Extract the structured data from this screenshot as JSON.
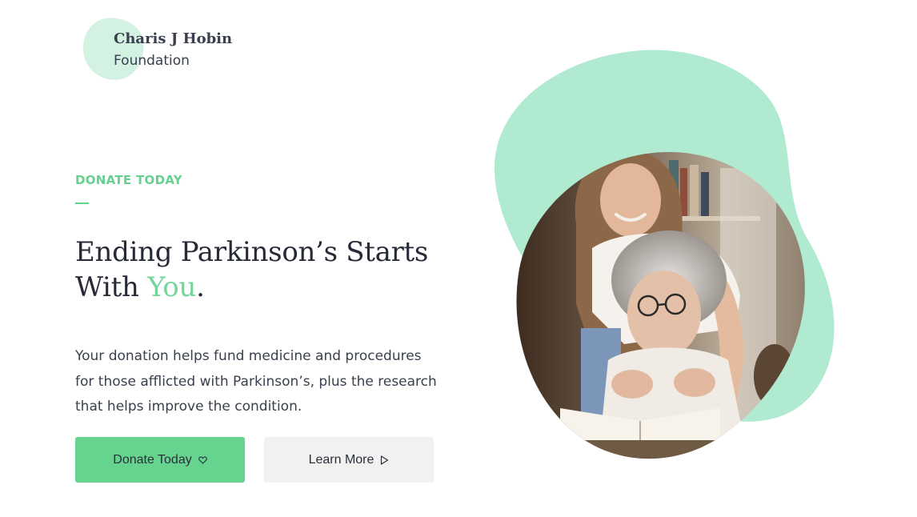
{
  "logo": {
    "line1": "Charis J Hobin",
    "line2": "Foundation"
  },
  "hero": {
    "eyebrow": "DONATE TODAY",
    "headline_part1": "Ending Parkinson’s Starts With ",
    "headline_accent": "You",
    "headline_end": ".",
    "description": "Your donation helps fund medicine and procedures for those afflicted with Parkinson’s, plus the research that helps improve the condition."
  },
  "buttons": {
    "donate_label": "Donate Today",
    "donate_icon": "heart-outline-icon",
    "learn_label": "Learn More",
    "learn_icon": "play-outline-icon"
  },
  "colors": {
    "accent": "#66d08f",
    "blob": "#b0ead0",
    "logo_blob": "#d3f2e2",
    "secondary_button": "#f1f1f1"
  }
}
